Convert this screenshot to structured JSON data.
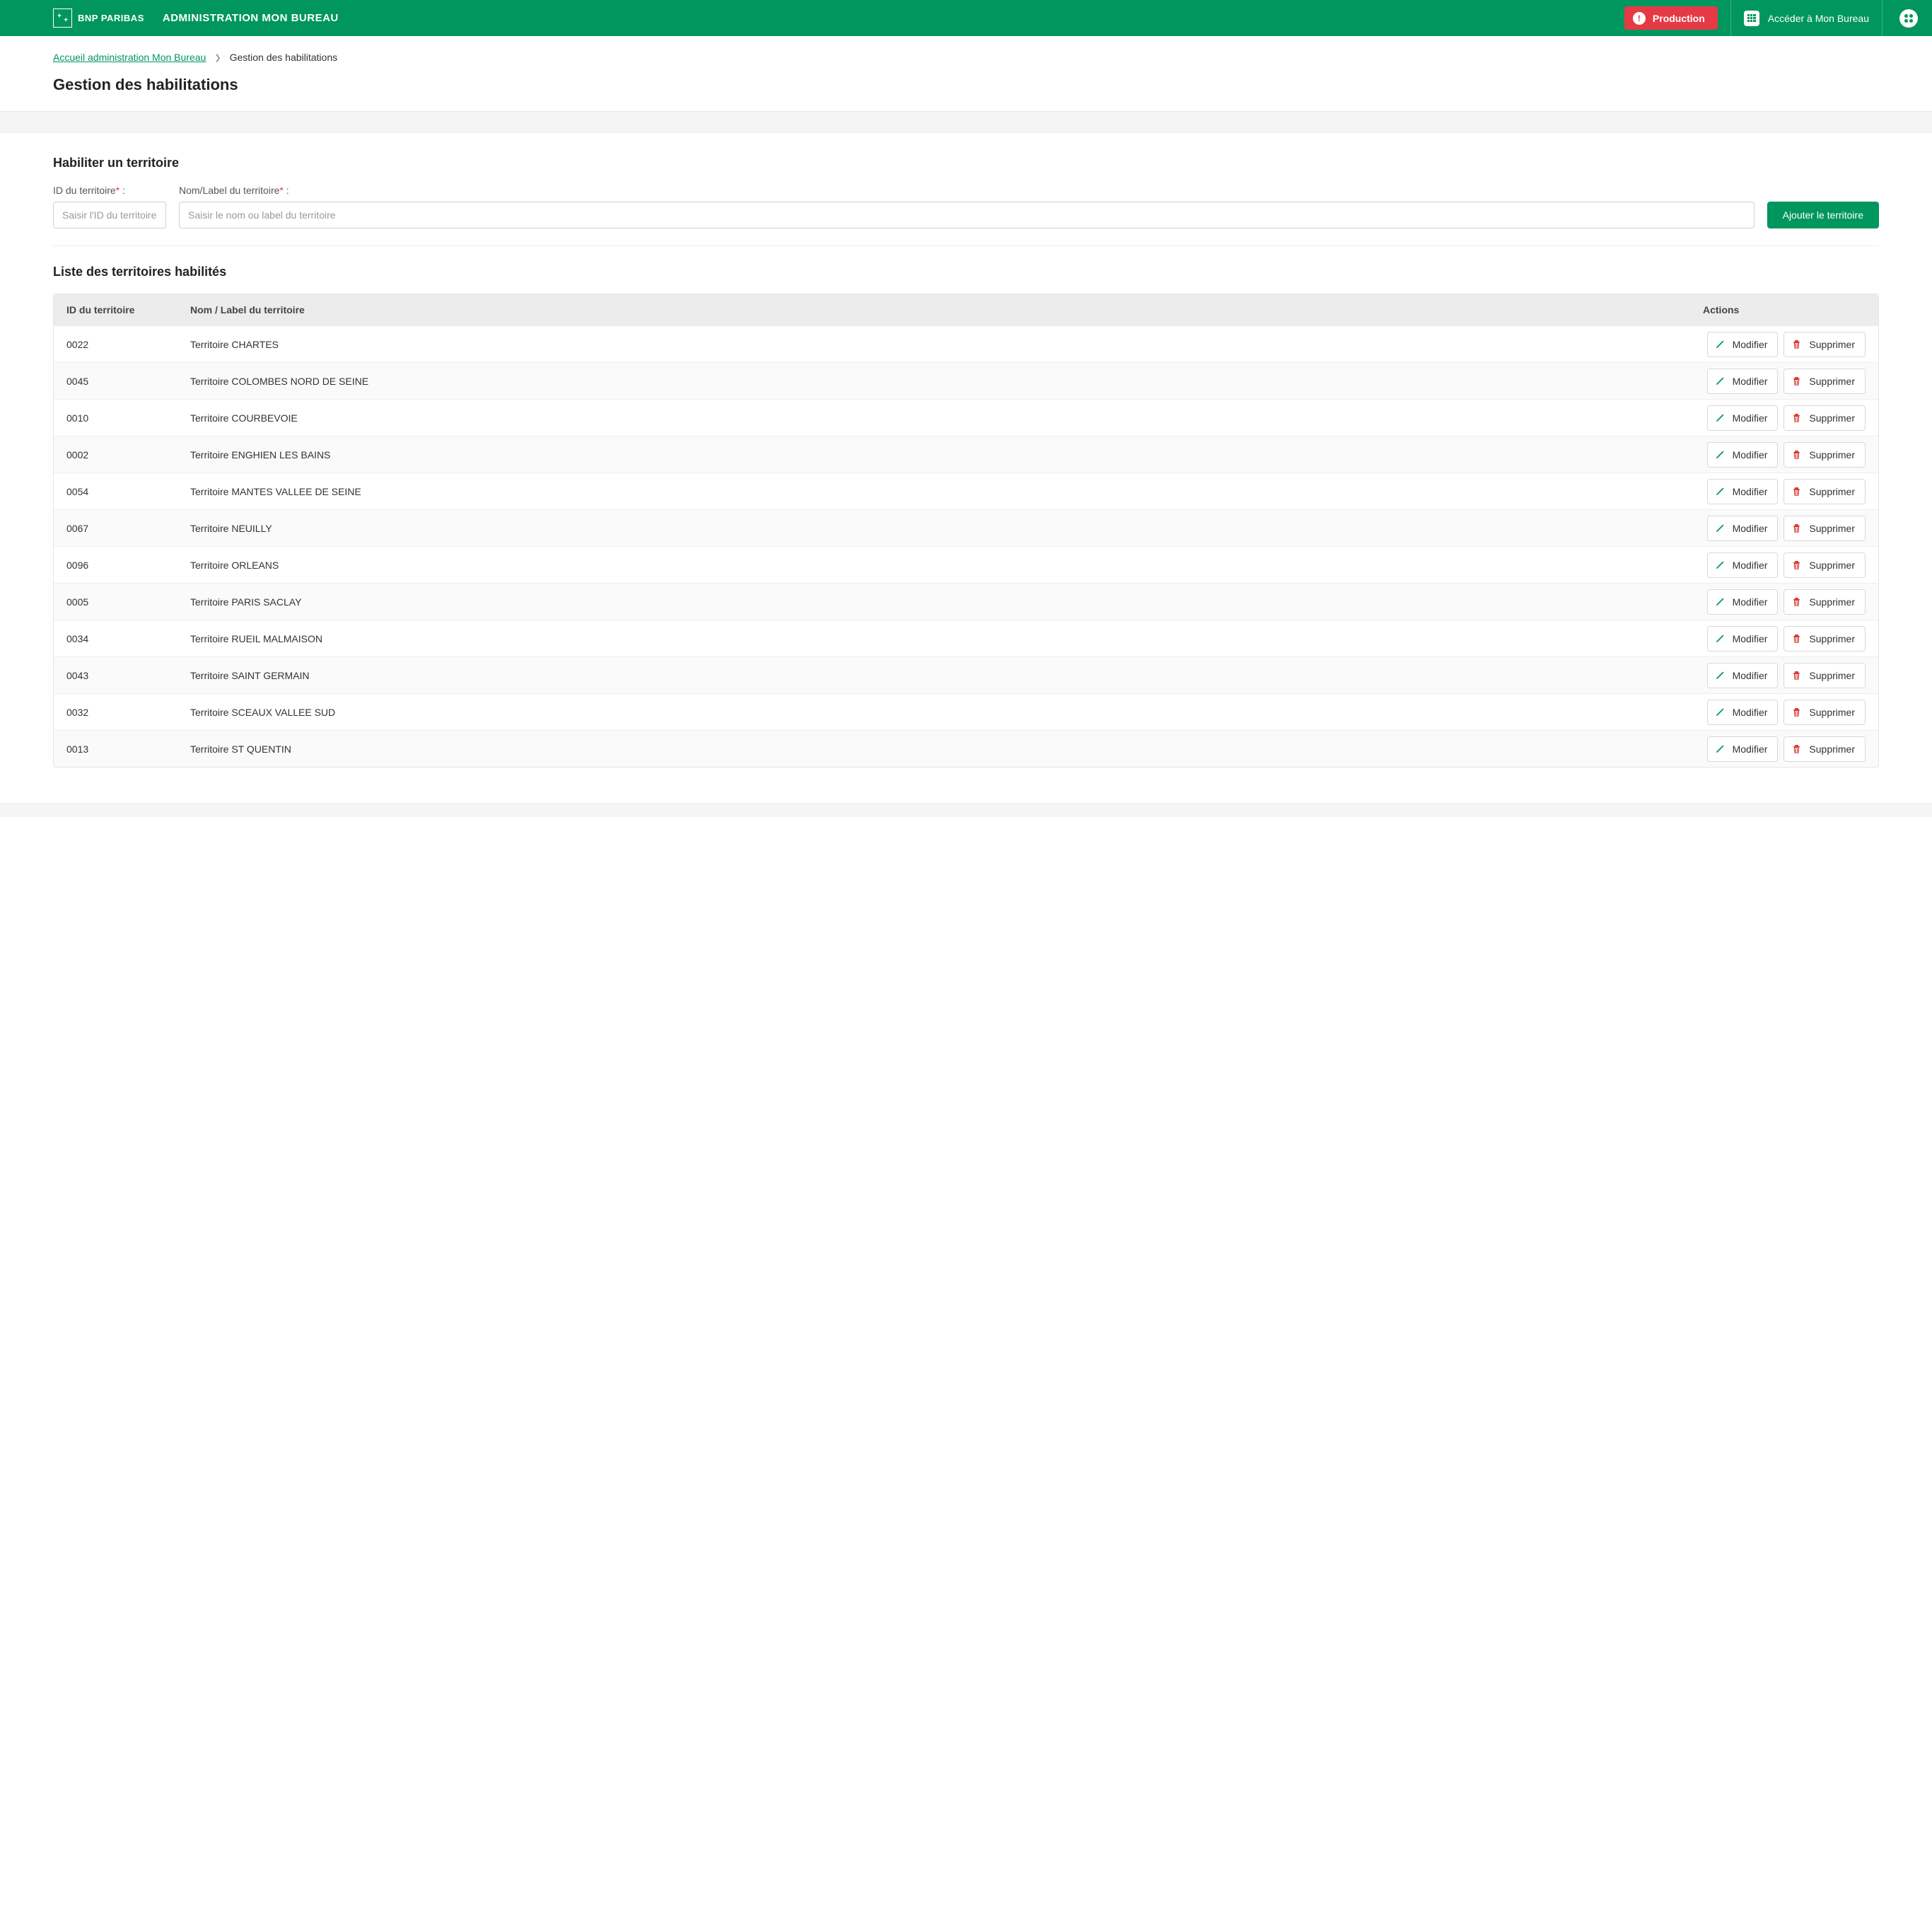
{
  "header": {
    "brand": "BNP PARIBAS",
    "app_title": "ADMINISTRATION MON BUREAU",
    "production_label": "Production",
    "access_label": "Accéder à Mon Bureau"
  },
  "breadcrumb": {
    "home": "Accueil administration Mon Bureau",
    "current": "Gestion des habilitations"
  },
  "page_title": "Gestion des habilitations",
  "form": {
    "section_title": "Habiliter un territoire",
    "id_label": "ID du territoire",
    "id_suffix": " :",
    "id_placeholder": "Saisir l'ID du territoire",
    "name_label": "Nom/Label du territoire",
    "name_suffix": " :",
    "name_placeholder": "Saisir le nom ou label du territoire",
    "add_button": "Ajouter le territoire"
  },
  "list": {
    "section_title": "Liste des territoires habilités",
    "columns": {
      "id": "ID du territoire",
      "name": "Nom / Label du territoire",
      "actions": "Actions"
    },
    "modify_label": "Modifier",
    "delete_label": "Supprimer",
    "rows": [
      {
        "id": "0022",
        "name": "Territoire CHARTES"
      },
      {
        "id": "0045",
        "name": "Territoire COLOMBES NORD DE SEINE"
      },
      {
        "id": "0010",
        "name": "Territoire COURBEVOIE"
      },
      {
        "id": "0002",
        "name": "Territoire ENGHIEN LES BAINS"
      },
      {
        "id": "0054",
        "name": "Territoire MANTES VALLEE DE SEINE"
      },
      {
        "id": "0067",
        "name": "Territoire NEUILLY"
      },
      {
        "id": "0096",
        "name": "Territoire ORLEANS"
      },
      {
        "id": "0005",
        "name": "Territoire PARIS SACLAY"
      },
      {
        "id": "0034",
        "name": "Territoire RUEIL MALMAISON"
      },
      {
        "id": "0043",
        "name": "Territoire SAINT GERMAIN"
      },
      {
        "id": "0032",
        "name": "Territoire SCEAUX VALLEE SUD"
      },
      {
        "id": "0013",
        "name": "Territoire ST QUENTIN"
      }
    ]
  }
}
